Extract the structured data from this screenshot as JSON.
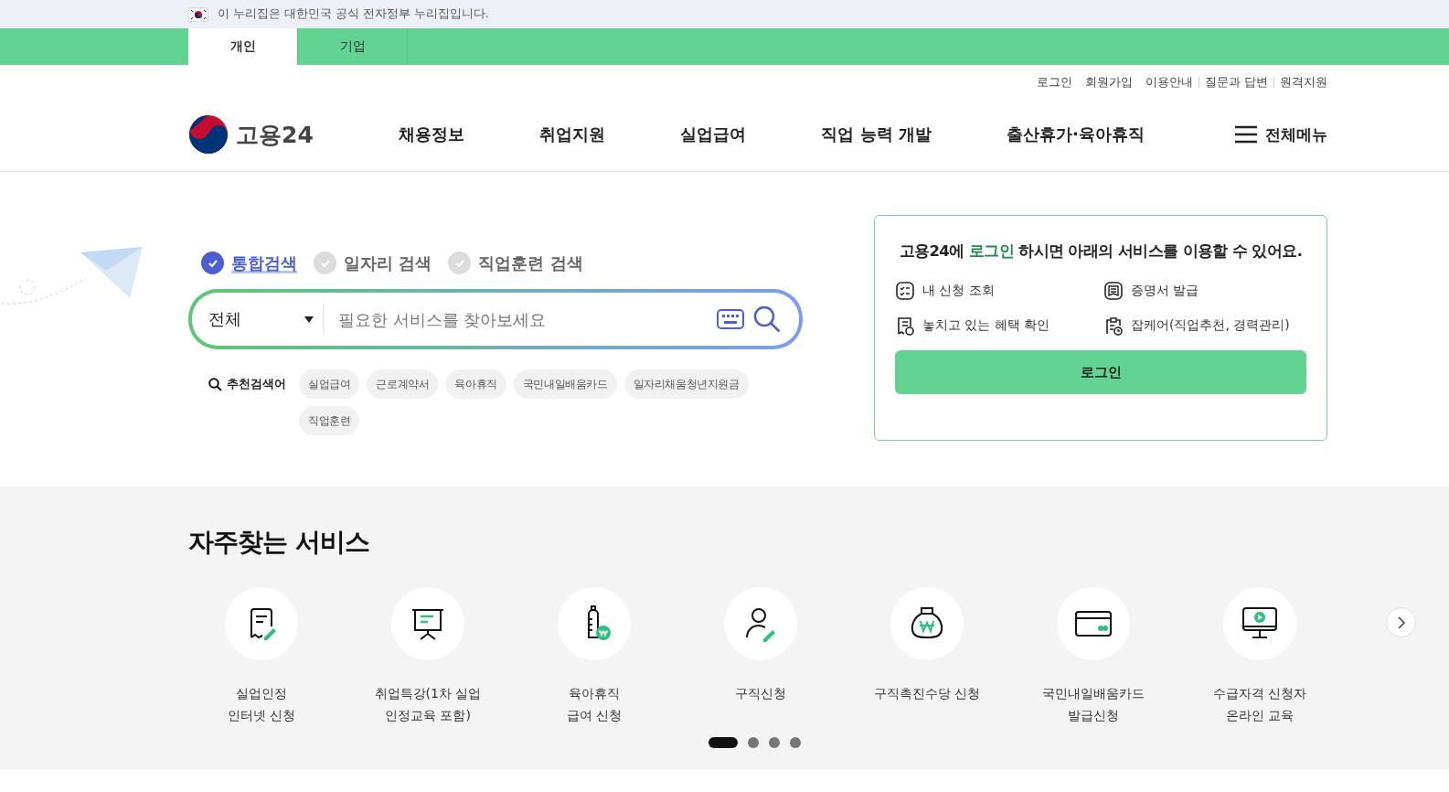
{
  "gov_banner": {
    "text": "이 누리집은 대한민국 공식 전자정부 누리집입니다."
  },
  "audience_tabs": [
    {
      "label": "개인",
      "selected": true
    },
    {
      "label": "기업",
      "selected": false
    }
  ],
  "util_links": [
    "로그인",
    "회원가입",
    "이용안내",
    "질문과 답변",
    "원격지원"
  ],
  "logo": {
    "text": "고용24"
  },
  "nav": [
    "채용정보",
    "취업지원",
    "실업급여",
    "직업 능력 개발",
    "출산휴가·육아휴직"
  ],
  "all_menu": "전체메뉴",
  "search": {
    "tabs": [
      {
        "label": "통합검색",
        "selected": true
      },
      {
        "label": "일자리 검색",
        "selected": false
      },
      {
        "label": "직업훈련 검색",
        "selected": false
      }
    ],
    "category": "전체",
    "placeholder": "필요한 서비스를 찾아보세요",
    "recommended_label": "추천검색어",
    "recommended": [
      "실업급여",
      "근로계약서",
      "육아휴직",
      "국민내일배움카드",
      "일자리채움청년지원금",
      "직업훈련"
    ]
  },
  "login_card": {
    "message": "고용24에 **로그인** 하시면 아래의 서비스를 이용할 수 있어요.",
    "services": [
      "내 신청 조회",
      "증명서 발급",
      "놓치고 있는 혜택 확인",
      "잡케어(직업추천, 경력관리)"
    ],
    "button": "로그인"
  },
  "frequent": {
    "title": "자주찾는 서비스",
    "items": [
      "실업인정\n인터넷 신청",
      "취업특강(1차 실업\n인정교육 포함)",
      "육아휴직\n급여 신청",
      "구직신청",
      "구직촉진수당 신청",
      "국민내일배움카드\n발급신청",
      "수급자격 신청자\n온라인 교육"
    ],
    "pages": [
      {
        "selected": true
      },
      {
        "selected": false
      },
      {
        "selected": false
      },
      {
        "selected": false
      }
    ]
  }
}
